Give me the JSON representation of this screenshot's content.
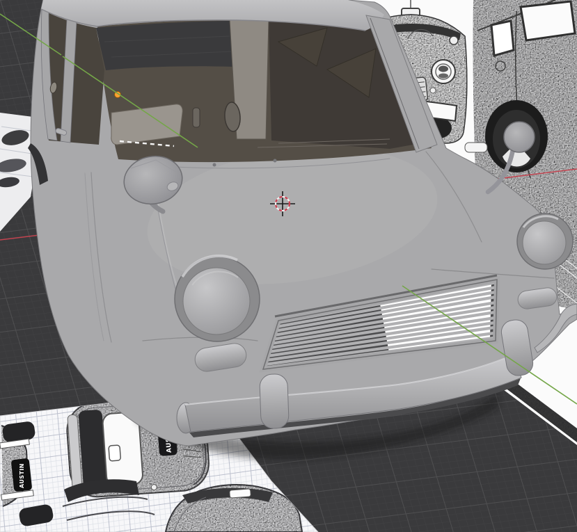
{
  "app": {
    "name": "3d-viewport",
    "description": "3D modeling viewport showing a classic Mini car body model with blueprint reference images"
  },
  "viewport": {
    "background_color": "#3a3a3c",
    "grid_line_color": "#4a4a4d",
    "axis_x_color": "#c2434f",
    "axis_y_color": "#74a648",
    "cursor_red": "#cc3b4c",
    "cursor_white": "#f0f0f0",
    "origin_color": "#ffa030"
  },
  "model": {
    "name": "mini-car-body",
    "body_color": "#a9a9ab",
    "interior_color": "#534d45"
  },
  "references": {
    "badge_text": "AUSTIN",
    "front_sketch": "front-view-reference",
    "rear_sketch": "rear-quarter-reference",
    "blueprint": "top-view-blueprint"
  }
}
